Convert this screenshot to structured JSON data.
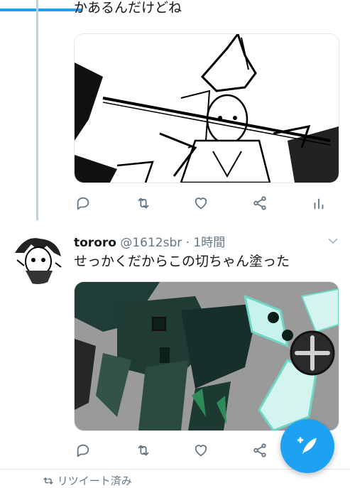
{
  "thread": {
    "previous_tweet_text": "かあるんだけどね"
  },
  "tweet": {
    "display_name": "tororo",
    "handle": "@1612sbr",
    "separator": "·",
    "time": "1時間",
    "text": "せっかくだからこの切ちゃん塗った"
  },
  "footer": {
    "retweet_notice": "リツイート済み"
  },
  "icons": [
    "reply-icon",
    "retweet-icon",
    "like-icon",
    "share-icon",
    "analytics-icon",
    "chevron-down-icon",
    "compose-icon"
  ],
  "colors": {
    "accent": "#1da1f2",
    "icon_gray": "#657786",
    "thread_line": "#b8d3e8",
    "artwork_teal": "#1f3d37"
  }
}
